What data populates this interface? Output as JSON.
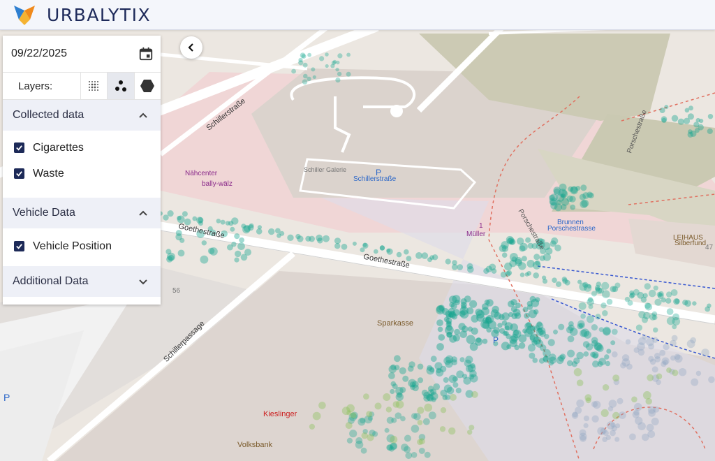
{
  "header": {
    "brand": "URBALYTIX"
  },
  "panel": {
    "date": "09/22/2025",
    "layers_label": "Layers:",
    "layer_buttons": [
      "heatmap-icon",
      "points-icon",
      "hexagon-icon"
    ],
    "sections": [
      {
        "title": "Collected data",
        "expanded": true,
        "items": [
          {
            "label": "Cigarettes",
            "checked": true
          },
          {
            "label": "Waste",
            "checked": true
          }
        ]
      },
      {
        "title": "Vehicle Data",
        "expanded": true,
        "items": [
          {
            "label": "Vehicle Position",
            "checked": true
          }
        ]
      },
      {
        "title": "Additional Data",
        "expanded": false,
        "items": []
      }
    ]
  },
  "map": {
    "labels": {
      "goethe1": "Goethestraße",
      "goethe2": "Goethestraße",
      "schiller": "Schillerstraße",
      "schillerpassage": "Schillerpassage",
      "parking": "Schillerstraße",
      "sparkasse": "Sparkasse",
      "kieslinger": "Kieslinger",
      "volksbank": "Volksbank",
      "brunnen": "Brunnen",
      "porsche": "Porschestrasse",
      "leihaus": "LEIHAUS",
      "silberfund": "Silberfund",
      "mueller": "Müller",
      "porschestr": "Porschestraße",
      "porschestr2": "Porschestraße",
      "naehcenter": "Nähcenter",
      "bally": "bally-wälz",
      "schiller_galerie": "Schiller Galerie",
      "num56": "56",
      "num1": "1",
      "num47": "47"
    },
    "colors": {
      "dot": "#14a58f",
      "waste": "#8cc05a",
      "vehicle": "#8ea7c4"
    }
  }
}
